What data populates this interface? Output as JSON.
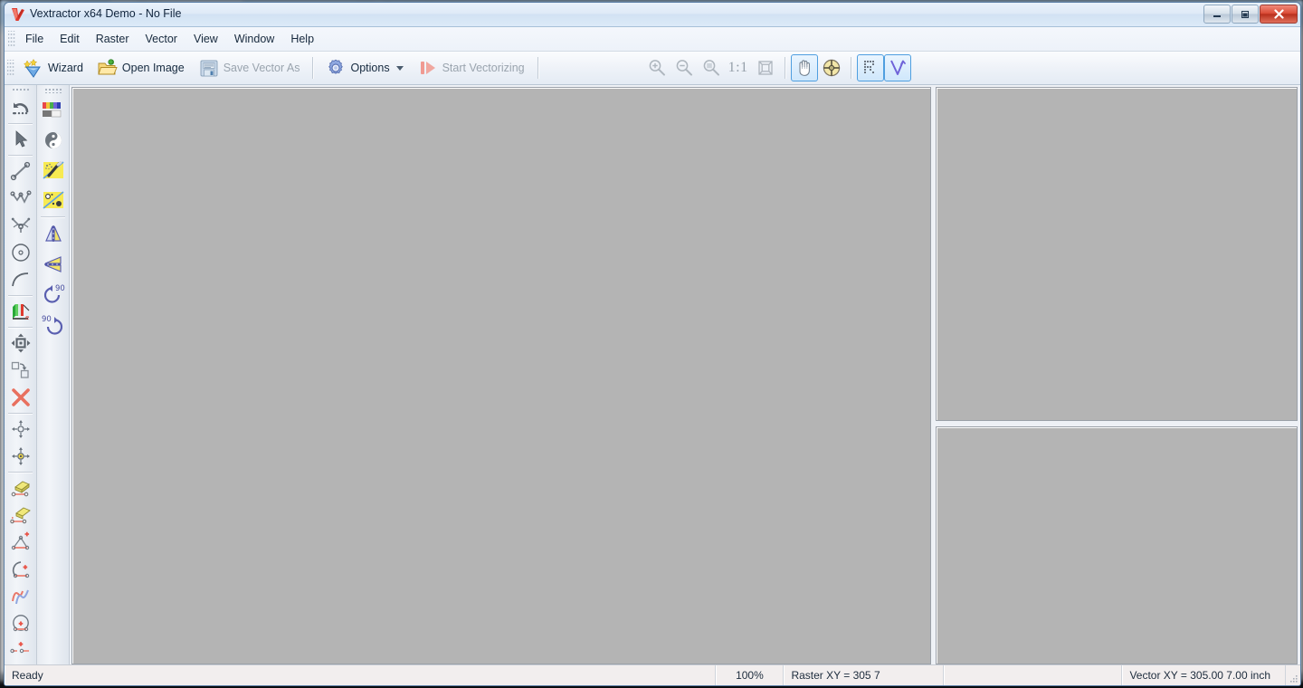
{
  "window": {
    "title": "Vextractor x64 Demo - No File",
    "app_icon": "vextractor-logo-icon",
    "controls": {
      "minimize": "minimize-icon",
      "maximize": "maximize-icon",
      "close": "close-icon"
    }
  },
  "menubar": {
    "items": [
      {
        "label": "File"
      },
      {
        "label": "Edit"
      },
      {
        "label": "Raster"
      },
      {
        "label": "Vector"
      },
      {
        "label": "View"
      },
      {
        "label": "Window"
      },
      {
        "label": "Help"
      }
    ]
  },
  "toolbar": {
    "wizard_label": "Wizard",
    "open_image_label": "Open Image",
    "save_vector_as_label": "Save Vector As",
    "options_label": "Options",
    "start_vectorizing_label": "Start Vectorizing",
    "ratio_label": "1:1",
    "icons": {
      "wizard": "wizard-wand-icon",
      "open_image": "open-folder-icon",
      "save_vector_as": "floppy-save-icon",
      "options": "gear-icon",
      "start_vectorizing": "play-vectorize-icon",
      "zoom_in": "zoom-in-icon",
      "zoom_out": "zoom-out-icon",
      "zoom_area": "zoom-area-icon",
      "fit_to_window": "fit-to-window-icon",
      "pan_hand": "pan-hand-icon",
      "center_target": "center-target-icon",
      "show_raster": "show-raster-icon",
      "show_vector": "show-vector-icon"
    },
    "toggles": {
      "pan_hand": true,
      "center_target": false,
      "show_raster": true,
      "show_vector": true
    },
    "disabled": [
      "save_vector_as",
      "start_vectorizing",
      "zoom_in",
      "zoom_out",
      "zoom_area",
      "fit_to_window",
      "ratio"
    ]
  },
  "left_toolbar": {
    "column_a": [
      {
        "name": "undo-tool"
      },
      {
        "name": "select-arrow-tool"
      },
      {
        "name": "line-tool"
      },
      {
        "name": "polyline-tool"
      },
      {
        "name": "node-edit-tool"
      },
      {
        "name": "circle-tool"
      },
      {
        "name": "arc-tool"
      },
      {
        "name": "gradient-layers-tool"
      },
      {
        "name": "move-object-tool"
      },
      {
        "name": "duplicate-object-tool"
      },
      {
        "name": "delete-object-tool"
      },
      {
        "name": "add-node-tool"
      },
      {
        "name": "add-center-node-tool"
      },
      {
        "name": "erase-segment-tool"
      },
      {
        "name": "erase-line-tool"
      },
      {
        "name": "add-polyline-node-tool"
      },
      {
        "name": "add-arc-node-tool"
      },
      {
        "name": "smooth-curve-tool"
      },
      {
        "name": "add-circle-node-tool"
      },
      {
        "name": "add-point-tool"
      }
    ],
    "column_b": [
      {
        "name": "color-palette-tool"
      },
      {
        "name": "grayscale-tool"
      },
      {
        "name": "invert-yinyang-tool"
      },
      {
        "name": "despeckle-wand-tool"
      },
      {
        "name": "noise-filter-tool"
      },
      {
        "name": "flip-vertical-tool"
      },
      {
        "name": "flip-horizontal-tool"
      },
      {
        "name": "rotate-cw-90-tool"
      },
      {
        "name": "rotate-ccw-90-tool"
      }
    ],
    "rotate_labels": {
      "cw": "90",
      "ccw": "90"
    }
  },
  "panels": {
    "canvas": {
      "name": "raster-canvas",
      "background": "#b4b4b4"
    },
    "top_pane": {
      "name": "vector-preview-pane",
      "background": "#b4b4b4"
    },
    "bottom_pane": {
      "name": "properties-pane",
      "background": "#b4b4b4"
    }
  },
  "statusbar": {
    "ready_text": "Ready",
    "zoom": "100%",
    "raster_xy": "Raster XY =  305    7",
    "mid": "",
    "vector_xy": "Vector XY = 305.00  7.00 inch"
  },
  "colors": {
    "accent": "#4f9fe0",
    "canvas_gray": "#b4b4b4",
    "title_blue": "#d2e2f3",
    "close_red": "#da4b36"
  }
}
